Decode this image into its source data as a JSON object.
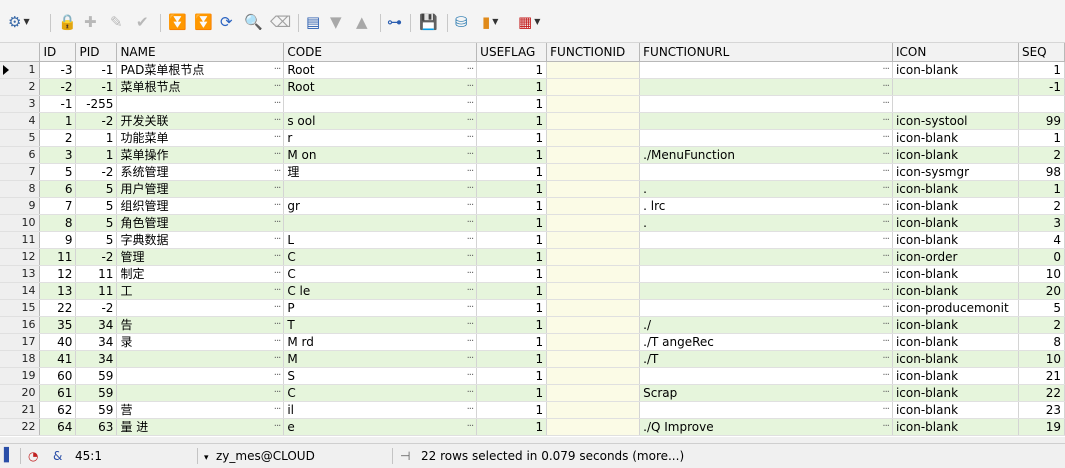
{
  "toolbar": {
    "icons": [
      {
        "name": "query-by-example-icon",
        "glyph": "⚙",
        "color": "#3a6aa8",
        "dropdown": true
      },
      {
        "name": "lock-icon",
        "glyph": "🔒",
        "color": "#b0182a"
      },
      {
        "name": "insert-record-icon",
        "glyph": "✚",
        "color": "#b8b8b8"
      },
      {
        "name": "delete-record-icon",
        "glyph": "✎",
        "color": "#b8b8b8"
      },
      {
        "name": "post-changes-icon",
        "glyph": "✔",
        "color": "#b8b8b8"
      },
      {
        "name": "next-page-icon",
        "glyph": "⏬",
        "color": "#2f8f2f"
      },
      {
        "name": "fetch-all-icon",
        "glyph": "⏬",
        "color": "#2f8f2f"
      },
      {
        "name": "refresh-icon",
        "glyph": "⟳",
        "color": "#2b64c2"
      },
      {
        "name": "find-icon",
        "glyph": "🔍",
        "color": "#333333"
      },
      {
        "name": "clear-icon",
        "glyph": "⌫",
        "color": "#a0a0a0"
      },
      {
        "name": "single-record-view-icon",
        "glyph": "▤",
        "color": "#2a5db0"
      },
      {
        "name": "sort-descending-icon",
        "glyph": "▼",
        "color": "#a8a8a8"
      },
      {
        "name": "sort-ascending-icon",
        "glyph": "▲",
        "color": "#a8a8a8"
      },
      {
        "name": "export-tree-icon",
        "glyph": "⊶",
        "color": "#2a5db0"
      },
      {
        "name": "save-icon",
        "glyph": "💾",
        "color": "#7a2a6a"
      },
      {
        "name": "connect-icon",
        "glyph": "⛁",
        "color": "#2a7ab0"
      },
      {
        "name": "chart-icon",
        "glyph": "▮",
        "color": "#e08a1a",
        "dropdown": true
      },
      {
        "name": "grid-view-icon",
        "glyph": "▦",
        "color": "#c41a1a",
        "dropdown": true
      }
    ]
  },
  "grid": {
    "columns": [
      "ID",
      "PID",
      "NAME",
      "CODE",
      "USEFLAG",
      "FUNCTIONID",
      "FUNCTIONURL",
      "ICON",
      "SEQ"
    ],
    "rows": [
      {
        "n": "1",
        "id": "-3",
        "pid": "-1",
        "name": "PAD菜单根节点",
        "code": "Root",
        "useflag": "1",
        "fid": "",
        "url": "",
        "icon": "icon-blank",
        "seq": "1"
      },
      {
        "n": "2",
        "id": "-2",
        "pid": "-1",
        "name": "菜单根节点",
        "code": "Root",
        "useflag": "1",
        "fid": "",
        "url": "",
        "icon": "",
        "seq": "-1"
      },
      {
        "n": "3",
        "id": "-1",
        "pid": "-255",
        "name": "",
        "code": "",
        "useflag": "1",
        "fid": "",
        "url": "",
        "icon": "",
        "seq": ""
      },
      {
        "n": "4",
        "id": "1",
        "pid": "-2",
        "name": "开发关联",
        "code": "s   ool",
        "useflag": "1",
        "fid": "",
        "url": "",
        "icon": "icon-systool",
        "seq": "99"
      },
      {
        "n": "5",
        "id": "2",
        "pid": "1",
        "name": "功能菜单",
        "code": "r",
        "useflag": "1",
        "fid": "",
        "url": "",
        "icon": "icon-blank",
        "seq": "1"
      },
      {
        "n": "6",
        "id": "3",
        "pid": "1",
        "name": "菜单操作",
        "code": "M        on",
        "useflag": "1",
        "fid": "",
        "url": "      ./MenuFunction",
        "icon": "icon-blank",
        "seq": "2"
      },
      {
        "n": "7",
        "id": "5",
        "pid": "-2",
        "name": "系统管理",
        "code": "     理",
        "useflag": "1",
        "fid": "",
        "url": "",
        "icon": "icon-sysmgr",
        "seq": "98"
      },
      {
        "n": "8",
        "id": "6",
        "pid": "5",
        "name": "用户管理",
        "code": "",
        "useflag": "1",
        "fid": "",
        "url": ".",
        "icon": "icon-blank",
        "seq": "1"
      },
      {
        "n": "9",
        "id": "7",
        "pid": "5",
        "name": "组织管理",
        "code": "      gr",
        "useflag": "1",
        "fid": "",
        "url": ".     lrc",
        "icon": "icon-blank",
        "seq": "2"
      },
      {
        "n": "10",
        "id": "8",
        "pid": "5",
        "name": "角色管理",
        "code": "",
        "useflag": "1",
        "fid": "",
        "url": ".",
        "icon": "icon-blank",
        "seq": "3"
      },
      {
        "n": "11",
        "id": "9",
        "pid": "5",
        "name": "字典数据",
        "code": "L",
        "useflag": "1",
        "fid": "",
        "url": "",
        "icon": "icon-blank",
        "seq": "4"
      },
      {
        "n": "12",
        "id": "11",
        "pid": "-2",
        "name": "  管理",
        "code": "C",
        "useflag": "1",
        "fid": "",
        "url": "",
        "icon": "icon-order",
        "seq": "0"
      },
      {
        "n": "13",
        "id": "12",
        "pid": "11",
        "name": "   制定",
        "code": "C",
        "useflag": "1",
        "fid": "",
        "url": "",
        "icon": "icon-blank",
        "seq": "10"
      },
      {
        "n": "14",
        "id": "13",
        "pid": "11",
        "name": "工",
        "code": "C        le",
        "useflag": "1",
        "fid": "",
        "url": "",
        "icon": "icon-blank",
        "seq": "20"
      },
      {
        "n": "15",
        "id": "22",
        "pid": "-2",
        "name": "",
        "code": "P",
        "useflag": "1",
        "fid": "",
        "url": "",
        "icon": "icon-producemonit",
        "seq": "5"
      },
      {
        "n": "16",
        "id": "35",
        "pid": "34",
        "name": "          告",
        "code": "T",
        "useflag": "1",
        "fid": "",
        "url": "./",
        "icon": "icon-blank",
        "seq": "2"
      },
      {
        "n": "17",
        "id": "40",
        "pid": "34",
        "name": "              录",
        "code": "M                  rd",
        "useflag": "1",
        "fid": "",
        "url": "./T                 angeRec",
        "icon": "icon-blank",
        "seq": "8"
      },
      {
        "n": "18",
        "id": "41",
        "pid": "34",
        "name": "",
        "code": "M",
        "useflag": "1",
        "fid": "",
        "url": "./T",
        "icon": "icon-blank",
        "seq": "10"
      },
      {
        "n": "19",
        "id": "60",
        "pid": "59",
        "name": "",
        "code": "S",
        "useflag": "1",
        "fid": "",
        "url": "",
        "icon": "icon-blank",
        "seq": "21"
      },
      {
        "n": "20",
        "id": "61",
        "pid": "59",
        "name": "",
        "code": "C",
        "useflag": "1",
        "fid": "",
        "url": "          Scrap",
        "icon": "icon-blank",
        "seq": "22"
      },
      {
        "n": "21",
        "id": "62",
        "pid": "59",
        "name": "     营",
        "code": "       il",
        "useflag": "1",
        "fid": "",
        "url": "",
        "icon": "icon-blank",
        "seq": "23"
      },
      {
        "n": "22",
        "id": "64",
        "pid": "63",
        "name": "量          进",
        "code": "          e",
        "useflag": "1",
        "fid": "",
        "url": "./Q        Improve",
        "icon": "icon-blank",
        "seq": "19"
      }
    ]
  },
  "status": {
    "position": "45:1",
    "connection": "zy_mes@CLOUD",
    "message": "22 rows selected in 0.079 seconds (more...)"
  },
  "colors": {
    "row_even": "#e6f5dc",
    "row_odd": "#ffffff",
    "functionid_cell": "#fbfbe6"
  }
}
